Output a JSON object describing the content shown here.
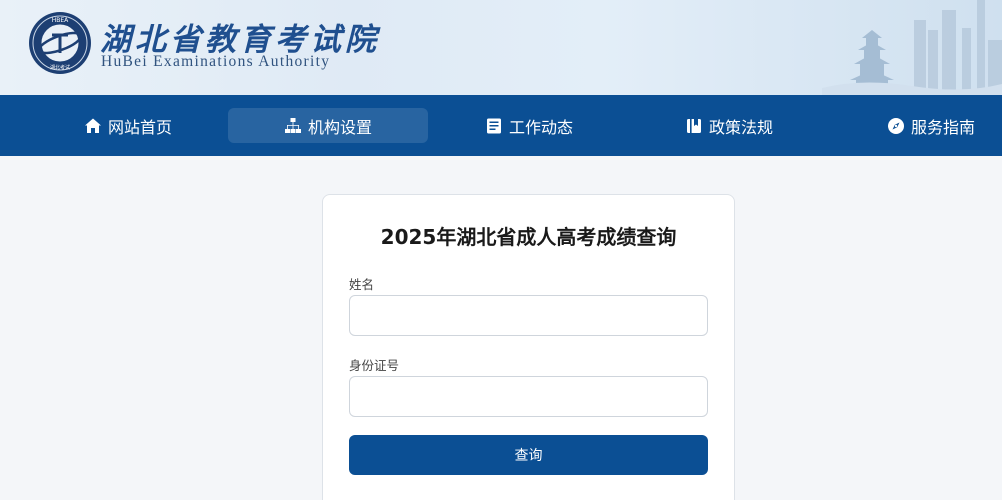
{
  "header": {
    "title_cn": "湖北省教育考试院",
    "title_en": "HuBei Examinations Authority",
    "emblem_text_top": "HBEA",
    "emblem_text_bottom": "湖北考试"
  },
  "nav": {
    "items": [
      {
        "label": "网站首页",
        "icon": "home-icon",
        "active": false
      },
      {
        "label": "机构设置",
        "icon": "org-chart-icon",
        "active": true
      },
      {
        "label": "工作动态",
        "icon": "news-icon",
        "active": false
      },
      {
        "label": "政策法规",
        "icon": "book-icon",
        "active": false
      },
      {
        "label": "服务指南",
        "icon": "compass-icon",
        "active": false
      }
    ]
  },
  "form": {
    "title": "2025年湖北省成人高考成绩查询",
    "name_label": "姓名",
    "name_value": "",
    "id_label": "身份证号",
    "id_value": "",
    "submit_label": "查询"
  },
  "colors": {
    "primary": "#0b4f94",
    "header_bg": "#e3eef8",
    "page_bg": "#f4f6f9"
  }
}
